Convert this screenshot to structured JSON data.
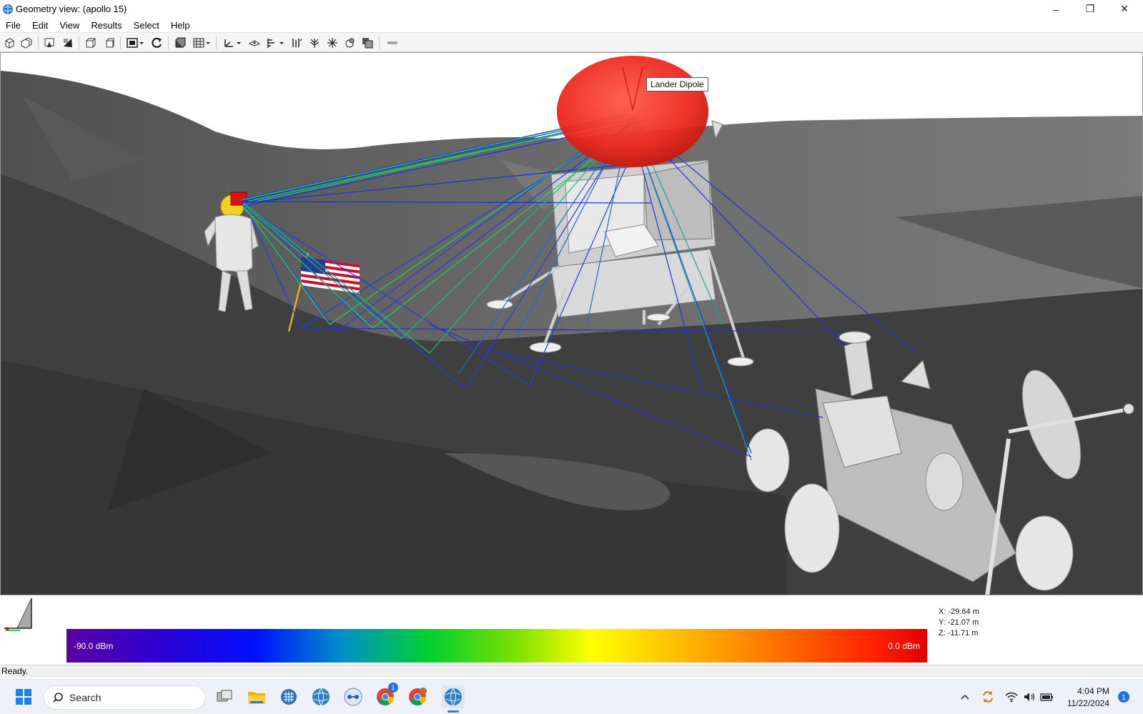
{
  "window": {
    "title": "Geometry view: (apollo 15)",
    "controls": {
      "minimize": "–",
      "restore": "❐",
      "close": "✕"
    }
  },
  "menu": [
    "File",
    "Edit",
    "View",
    "Results",
    "Select",
    "Help"
  ],
  "viewport": {
    "tooltip": "Lander Dipole"
  },
  "legend": {
    "min_label": "-90.0 dBm",
    "max_label": "0.0 dBm",
    "colors": [
      "#5a00a0",
      "#0010ff",
      "#00d030",
      "#ffff00",
      "#ff6000",
      "#e00000"
    ]
  },
  "coordinates": {
    "x": "X: -29.64 m",
    "y": "Y: -21.07 m",
    "z": "Z: -11.71 m"
  },
  "status": "Ready.",
  "taskbar": {
    "search_label": "Search",
    "time": "4:04 PM",
    "date": "11/22/2024",
    "chrome_badge": "1"
  }
}
